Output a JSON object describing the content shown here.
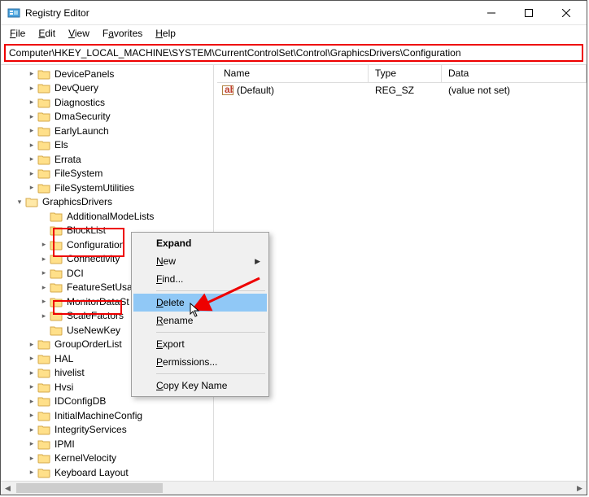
{
  "window": {
    "title": "Registry Editor"
  },
  "menu": {
    "file": "File",
    "edit": "Edit",
    "view": "View",
    "favorites": "Favorites",
    "help": "Help"
  },
  "address": "Computer\\HKEY_LOCAL_MACHINE\\SYSTEM\\CurrentControlSet\\Control\\GraphicsDrivers\\Configuration",
  "columns": {
    "name": "Name",
    "type": "Type",
    "data": "Data"
  },
  "row": {
    "name": "(Default)",
    "type": "REG_SZ",
    "data": "(value not set)"
  },
  "tree": {
    "siblings_before": [
      "DevicePanels",
      "DevQuery",
      "Diagnostics",
      "DmaSecurity",
      "EarlyLaunch",
      "Els",
      "Errata",
      "FileSystem",
      "FileSystemUtilities"
    ],
    "graphics": "GraphicsDrivers",
    "children": [
      "AdditionalModeLists",
      "BlockList",
      "Configuration",
      "Connectivity",
      "DCI",
      "FeatureSetUsage",
      "MonitorDataStore",
      "ScaleFactors",
      "UseNewKey"
    ],
    "siblings_after": [
      "GroupOrderList",
      "HAL",
      "hivelist",
      "Hvsi",
      "IDConfigDB",
      "InitialMachineConfig",
      "IntegrityServices",
      "IPMI",
      "KernelVelocity",
      "Keyboard Layout"
    ]
  },
  "context": {
    "expand": "Expand",
    "new": "New",
    "find": "Find...",
    "delete": "Delete",
    "rename": "Rename",
    "export": "Export",
    "permissions": "Permissions...",
    "copy": "Copy Key Name"
  }
}
